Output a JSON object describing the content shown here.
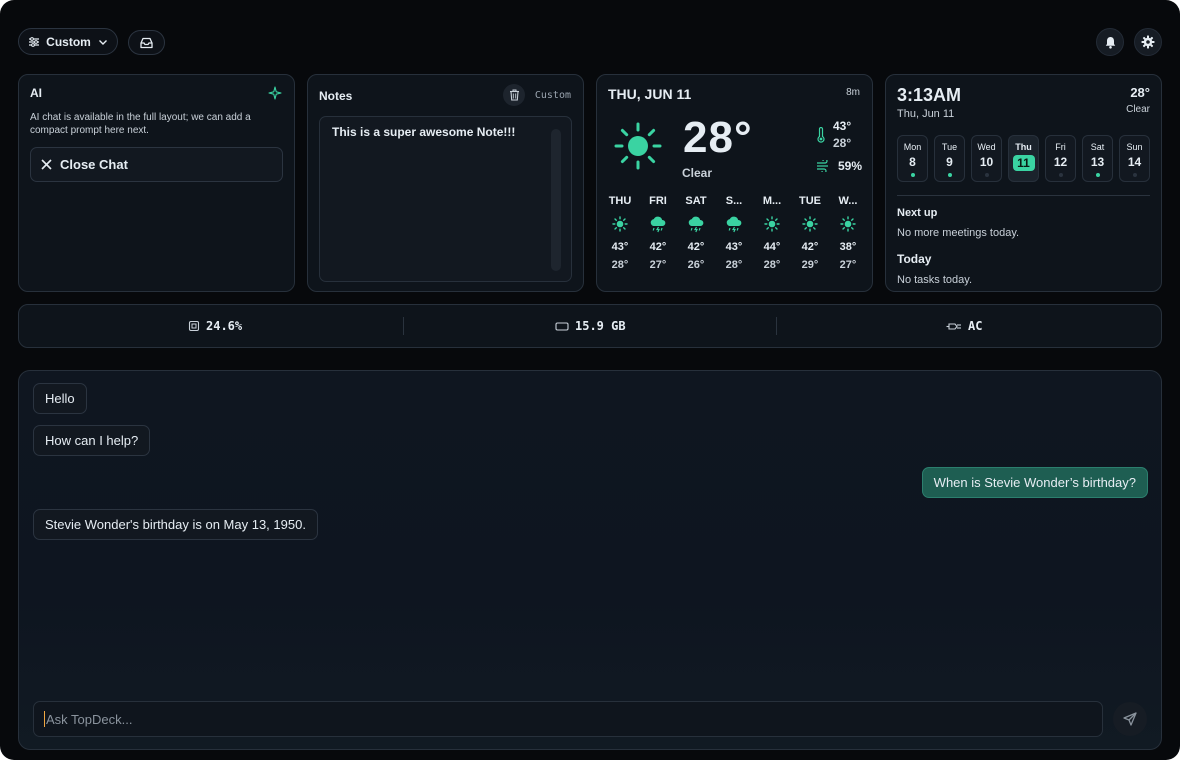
{
  "toolbar": {
    "layout_label": "Custom"
  },
  "ai_card": {
    "title": "AI",
    "description": "AI chat is available in the full layout; we can add a compact prompt here next.",
    "close_label": "Close Chat"
  },
  "notes": {
    "title": "Notes",
    "mode": "Custom",
    "content": "This is a super awesome Note!!!"
  },
  "weather": {
    "date": "THU, JUN 11",
    "updated": "8m",
    "temp": "28°",
    "condition": "Clear",
    "high": "43°",
    "low": "28°",
    "humidity": "59%",
    "forecast": [
      {
        "day": "THU",
        "icon": "sun-icon",
        "hi": "43°",
        "lo": "28°"
      },
      {
        "day": "FRI",
        "icon": "storm-icon",
        "hi": "42°",
        "lo": "27°"
      },
      {
        "day": "SAT",
        "icon": "storm-icon",
        "hi": "42°",
        "lo": "26°"
      },
      {
        "day": "S...",
        "icon": "storm-icon",
        "hi": "43°",
        "lo": "28°"
      },
      {
        "day": "M...",
        "icon": "sun-icon",
        "hi": "44°",
        "lo": "28°"
      },
      {
        "day": "TUE",
        "icon": "sun-icon",
        "hi": "42°",
        "lo": "29°"
      },
      {
        "day": "W...",
        "icon": "sun-icon",
        "hi": "38°",
        "lo": "27°"
      }
    ]
  },
  "calendar": {
    "time": "3:13AM",
    "date": "Thu, Jun 11",
    "temp": "28°",
    "condition": "Clear",
    "days": [
      {
        "name": "Mon",
        "num": "8",
        "event": true
      },
      {
        "name": "Tue",
        "num": "9",
        "event": true
      },
      {
        "name": "Wed",
        "num": "10",
        "event": false
      },
      {
        "name": "Thu",
        "num": "11",
        "event": false,
        "active": true
      },
      {
        "name": "Fri",
        "num": "12",
        "event": false
      },
      {
        "name": "Sat",
        "num": "13",
        "event": true
      },
      {
        "name": "Sun",
        "num": "14",
        "event": false
      }
    ],
    "next_up_heading": "Next up",
    "next_up_text": "No more meetings today.",
    "today_heading": "Today",
    "today_text": "No tasks today."
  },
  "stats": {
    "cpu": "24.6%",
    "memory": "15.9 GB",
    "power": "AC"
  },
  "chat": {
    "messages": [
      {
        "role": "assistant",
        "text": "Hello"
      },
      {
        "role": "assistant",
        "text": "How can I help?"
      },
      {
        "role": "user",
        "text": "When is Stevie Wonder’s birthday?"
      },
      {
        "role": "assistant",
        "text": "Stevie Wonder's birthday is on May 13, 1950."
      }
    ],
    "input_placeholder": "Ask TopDeck..."
  },
  "colors": {
    "accent": "#3ad3a2",
    "user_bubble": "#1e5e52",
    "background": "#07090c",
    "card": "#0e141b"
  }
}
